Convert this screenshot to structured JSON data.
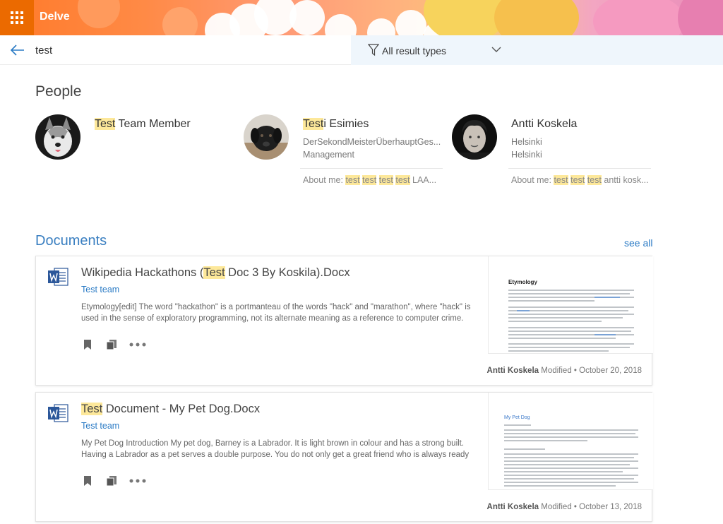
{
  "app": {
    "title": "Delve"
  },
  "search": {
    "query": "test"
  },
  "filter": {
    "label": "All result types"
  },
  "people": {
    "heading": "People",
    "items": [
      {
        "name_hl": "Test",
        "name_rest": " Team Member",
        "line1": "",
        "line2": "",
        "about_prefix": "",
        "about_hl": [],
        "about_rest": ""
      },
      {
        "name_hl": "Test",
        "name_rest": "i Esimies",
        "line1": "DerSekondMeisterÜberhauptGes...",
        "line2": "Management",
        "about_prefix": "About me: ",
        "about_hl": [
          "test",
          "test",
          "test",
          "test"
        ],
        "about_rest": " LAA..."
      },
      {
        "name_hl": "",
        "name_rest": "Antti Koskela",
        "line1": "Helsinki",
        "line2": "Helsinki",
        "about_prefix": "About me: ",
        "about_hl": [
          "test",
          "test",
          "test"
        ],
        "about_rest": " antti kosk..."
      }
    ]
  },
  "documents": {
    "heading": "Documents",
    "see_all": "see all",
    "items": [
      {
        "title_pre": "Wikipedia Hackathons (",
        "title_hl": "Test",
        "title_post": " Doc 3 By Koskila).Docx",
        "team": "Test team",
        "snippet": "Etymology[edit] The word \"hackathon\" is a portmanteau of the words \"hack\" and \"marathon\", where \"hack\" is used in the sense of exploratory programming, not its alternate meaning as a reference to computer crime. The",
        "author": "Antti Koskela",
        "modified": " Modified • October 20, 2018",
        "thumb_heading": "Etymology"
      },
      {
        "title_pre": "",
        "title_hl": "Test",
        "title_post": " Document - My Pet Dog.Docx",
        "team": "Test team",
        "snippet": "My Pet Dog Introduction My pet dog, Barney is a Labrador. It is light brown in colour and has a strong built. Having a Labrador as a pet serves a double purpose. You do not only get a great friend who is always ready to",
        "author": "Antti Koskela",
        "modified": " Modified • October 13, 2018",
        "thumb_heading": "My Pet Dog"
      }
    ]
  },
  "colors": {
    "accent": "#2b7bc5",
    "highlight": "#fde89a",
    "waffle": "#eb6a00"
  }
}
